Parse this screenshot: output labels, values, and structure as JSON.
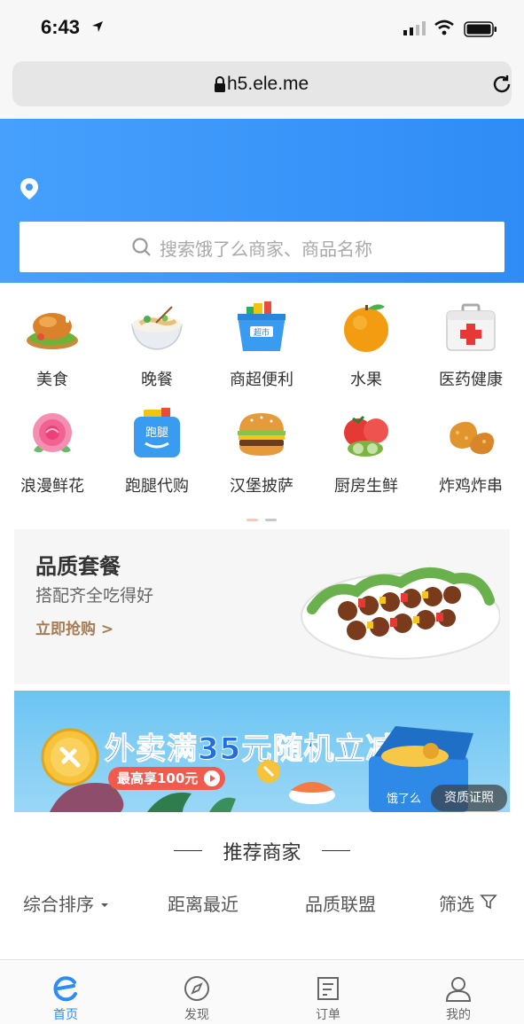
{
  "status_bar": {
    "time": "6:43"
  },
  "browser": {
    "url": "h5.ele.me"
  },
  "search": {
    "placeholder": "搜索饿了么商家、商品名称"
  },
  "categories": [
    {
      "label": "美食",
      "icon": "roast-chicken-icon"
    },
    {
      "label": "晚餐",
      "icon": "dinner-bowl-icon"
    },
    {
      "label": "商超便利",
      "icon": "supermarket-basket-icon"
    },
    {
      "label": "水果",
      "icon": "orange-fruit-icon"
    },
    {
      "label": "医药健康",
      "icon": "medical-kit-icon"
    },
    {
      "label": "浪漫鲜花",
      "icon": "rose-flower-icon"
    },
    {
      "label": "跑腿代购",
      "icon": "errand-bag-icon"
    },
    {
      "label": "汉堡披萨",
      "icon": "burger-icon"
    },
    {
      "label": "厨房生鲜",
      "icon": "vegetables-icon"
    },
    {
      "label": "炸鸡炸串",
      "icon": "fried-chicken-icon"
    }
  ],
  "quality_card": {
    "title": "品质套餐",
    "subtitle": "搭配齐全吃得好",
    "link": "立即抢购 >"
  },
  "promo_banner": {
    "title": "外卖满35元随机立减",
    "pill": "最高享100元",
    "badge": "资质证照",
    "brand": "饿了么"
  },
  "recommend": {
    "title": "推荐商家"
  },
  "sort_bar": {
    "items": [
      "综合排序",
      "距离最近",
      "品质联盟",
      "筛选"
    ]
  },
  "tabbar": {
    "tabs": [
      {
        "label": "首页",
        "icon": "home-e-icon",
        "active": true
      },
      {
        "label": "发现",
        "icon": "compass-icon",
        "active": false
      },
      {
        "label": "订单",
        "icon": "order-icon",
        "active": false
      },
      {
        "label": "我的",
        "icon": "profile-icon",
        "active": false
      }
    ]
  },
  "colors": {
    "brand_blue": "#2f8cf6",
    "accent_brown": "#a77c53",
    "promo_red": "#f25a4f"
  }
}
